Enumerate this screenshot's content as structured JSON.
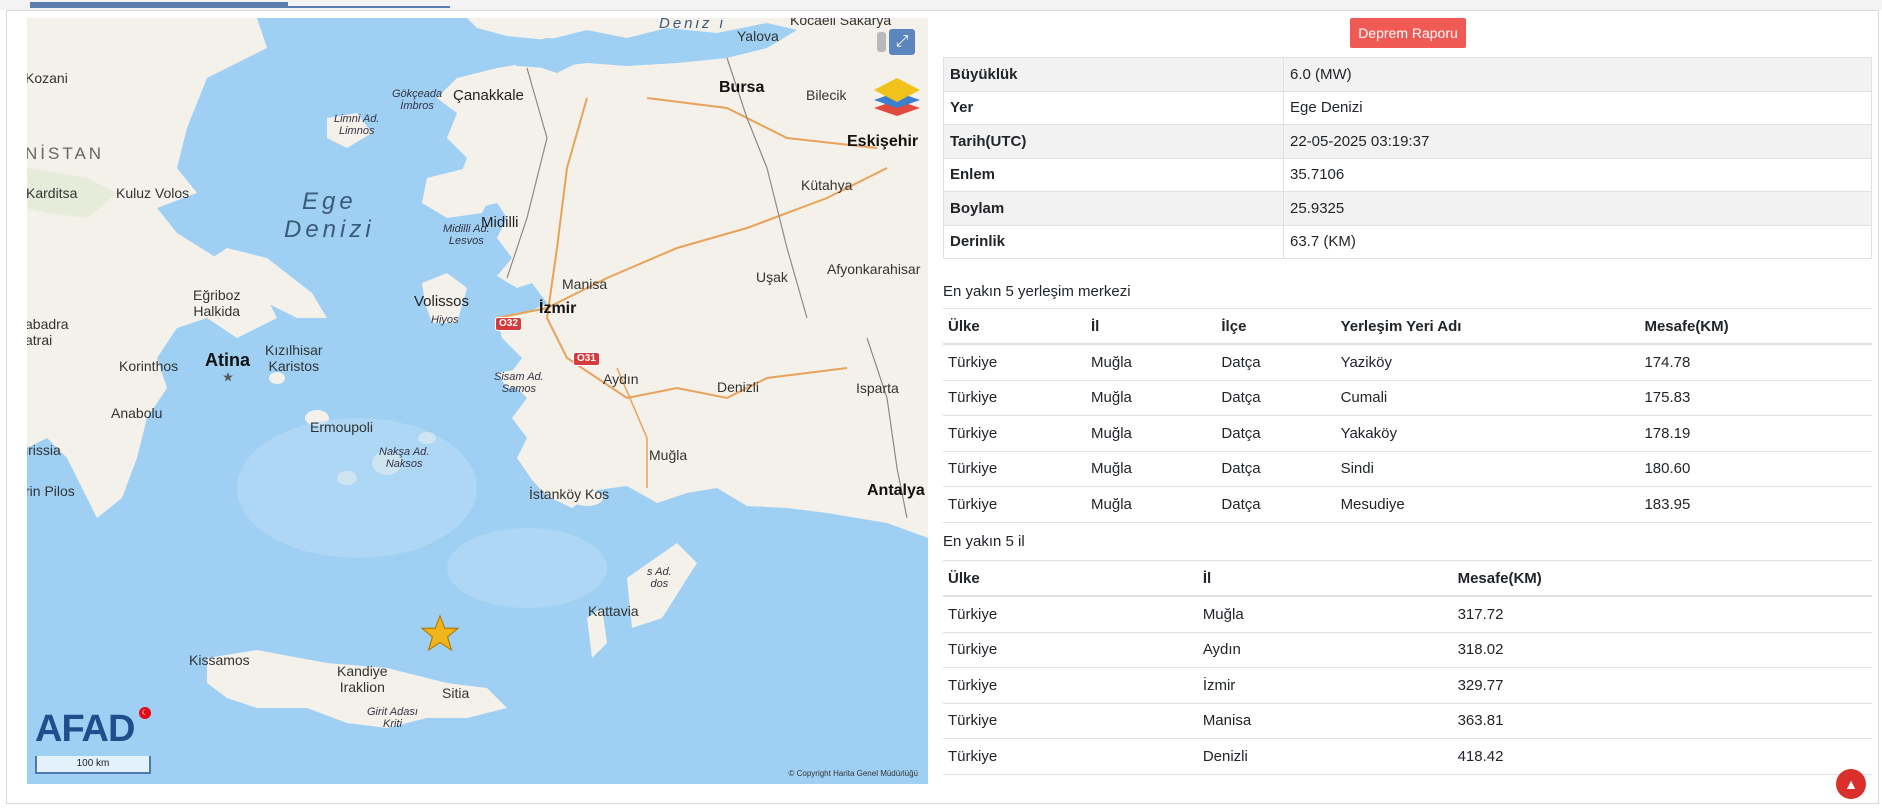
{
  "map": {
    "labels": {
      "yalova": "Yalova",
      "kocaeli_sakarya": "Kocaeli Sakarya",
      "deniz_top": "Deniz i",
      "bursa": "Bursa",
      "bilecik": "Bilecik",
      "canakkale": "Çanakkale",
      "gokceada": "Gökçeada\nİmbros",
      "limni": "Limni Ad.\nLimnos",
      "eskisehir": "Eskişehir",
      "kozani": "Kozani",
      "nistan": "NİSTAN",
      "karditsa": "Karditsa",
      "kuluz_volos": "Kuluz Volos",
      "ege_denizi": "Ege\nDenizi",
      "midilli_ad": "Midilli Ad.\nLesvos",
      "midilli": "Midilli",
      "kutahya": "Kütahya",
      "manisa": "Manisa",
      "usak": "Uşak",
      "afyonkarahisar": "Afyonkarahisar",
      "egriboz": "Eğriboz\nHalkida",
      "volissos": "Volissos",
      "hiyos": "Hiyos",
      "izmir": "İzmir",
      "abadra": "abadra\natrai",
      "atina": "Atina",
      "kizilhisar": "Kızılhisar\nKaristos",
      "korinthos": "Korinthos",
      "sisam": "Sisam Ad.\nSamos",
      "aydin": "Aydın",
      "denizli": "Denizli",
      "isparta": "Isparta",
      "anabolu": "Anabolu",
      "ermoupoli": "Ermoupoli",
      "naksa": "Nakşa Ad.\nNaksos",
      "mugla": "Muğla",
      "irissia": "irissia",
      "rin_pilos": "rin Pilos",
      "istankoy": "İstanköy Kos",
      "antalya": "Antalya",
      "rodos": "s Ad.\ndos",
      "kattavia": "Kattavia",
      "kissamos": "Kissamos",
      "kandiye": "Kandiye\nIraklion",
      "sitia": "Sitia",
      "girit": "Girit Adası\nKriti"
    },
    "roads": {
      "o32": "O32",
      "o31": "O31"
    },
    "logo": "AFAD",
    "scale": "100 km",
    "copyright": "© Copyright Harita Genel Müdürlüğü",
    "icons": {
      "expand": "expand-icon",
      "layers": "layers-icon",
      "epicenter": "star-icon"
    }
  },
  "report_button": "Deprem Raporu",
  "info": [
    {
      "key": "Büyüklük",
      "value": "6.0 (MW)"
    },
    {
      "key": "Yer",
      "value": "Ege Denizi"
    },
    {
      "key": "Tarih(UTC)",
      "value": "22-05-2025 03:19:37"
    },
    {
      "key": "Enlem",
      "value": "35.7106"
    },
    {
      "key": "Boylam",
      "value": "25.9325"
    },
    {
      "key": "Derinlik",
      "value": "63.7 (KM)"
    }
  ],
  "settlements": {
    "title": "En yakın 5 yerleşim merkezi",
    "headers": [
      "Ülke",
      "İl",
      "İlçe",
      "Yerleşim Yeri Adı",
      "Mesafe(KM)"
    ],
    "rows": [
      [
        "Türkiye",
        "Muğla",
        "Datça",
        "Yaziköy",
        "174.78"
      ],
      [
        "Türkiye",
        "Muğla",
        "Datça",
        "Cumali",
        "175.83"
      ],
      [
        "Türkiye",
        "Muğla",
        "Datça",
        "Yakaköy",
        "178.19"
      ],
      [
        "Türkiye",
        "Muğla",
        "Datça",
        "Sindi",
        "180.60"
      ],
      [
        "Türkiye",
        "Muğla",
        "Datça",
        "Mesudiye",
        "183.95"
      ]
    ]
  },
  "provinces": {
    "title": "En yakın 5 il",
    "headers": [
      "Ülke",
      "İl",
      "Mesafe(KM)"
    ],
    "rows": [
      [
        "Türkiye",
        "Muğla",
        "317.72"
      ],
      [
        "Türkiye",
        "Aydın",
        "318.02"
      ],
      [
        "Türkiye",
        "İzmir",
        "329.77"
      ],
      [
        "Türkiye",
        "Manisa",
        "363.81"
      ],
      [
        "Türkiye",
        "Denizli",
        "418.42"
      ]
    ]
  },
  "colors": {
    "report_button": "#f05a54",
    "scroll_top": "#d9302b",
    "sea": "#9fd0f3",
    "land": "#f3f1e9"
  }
}
